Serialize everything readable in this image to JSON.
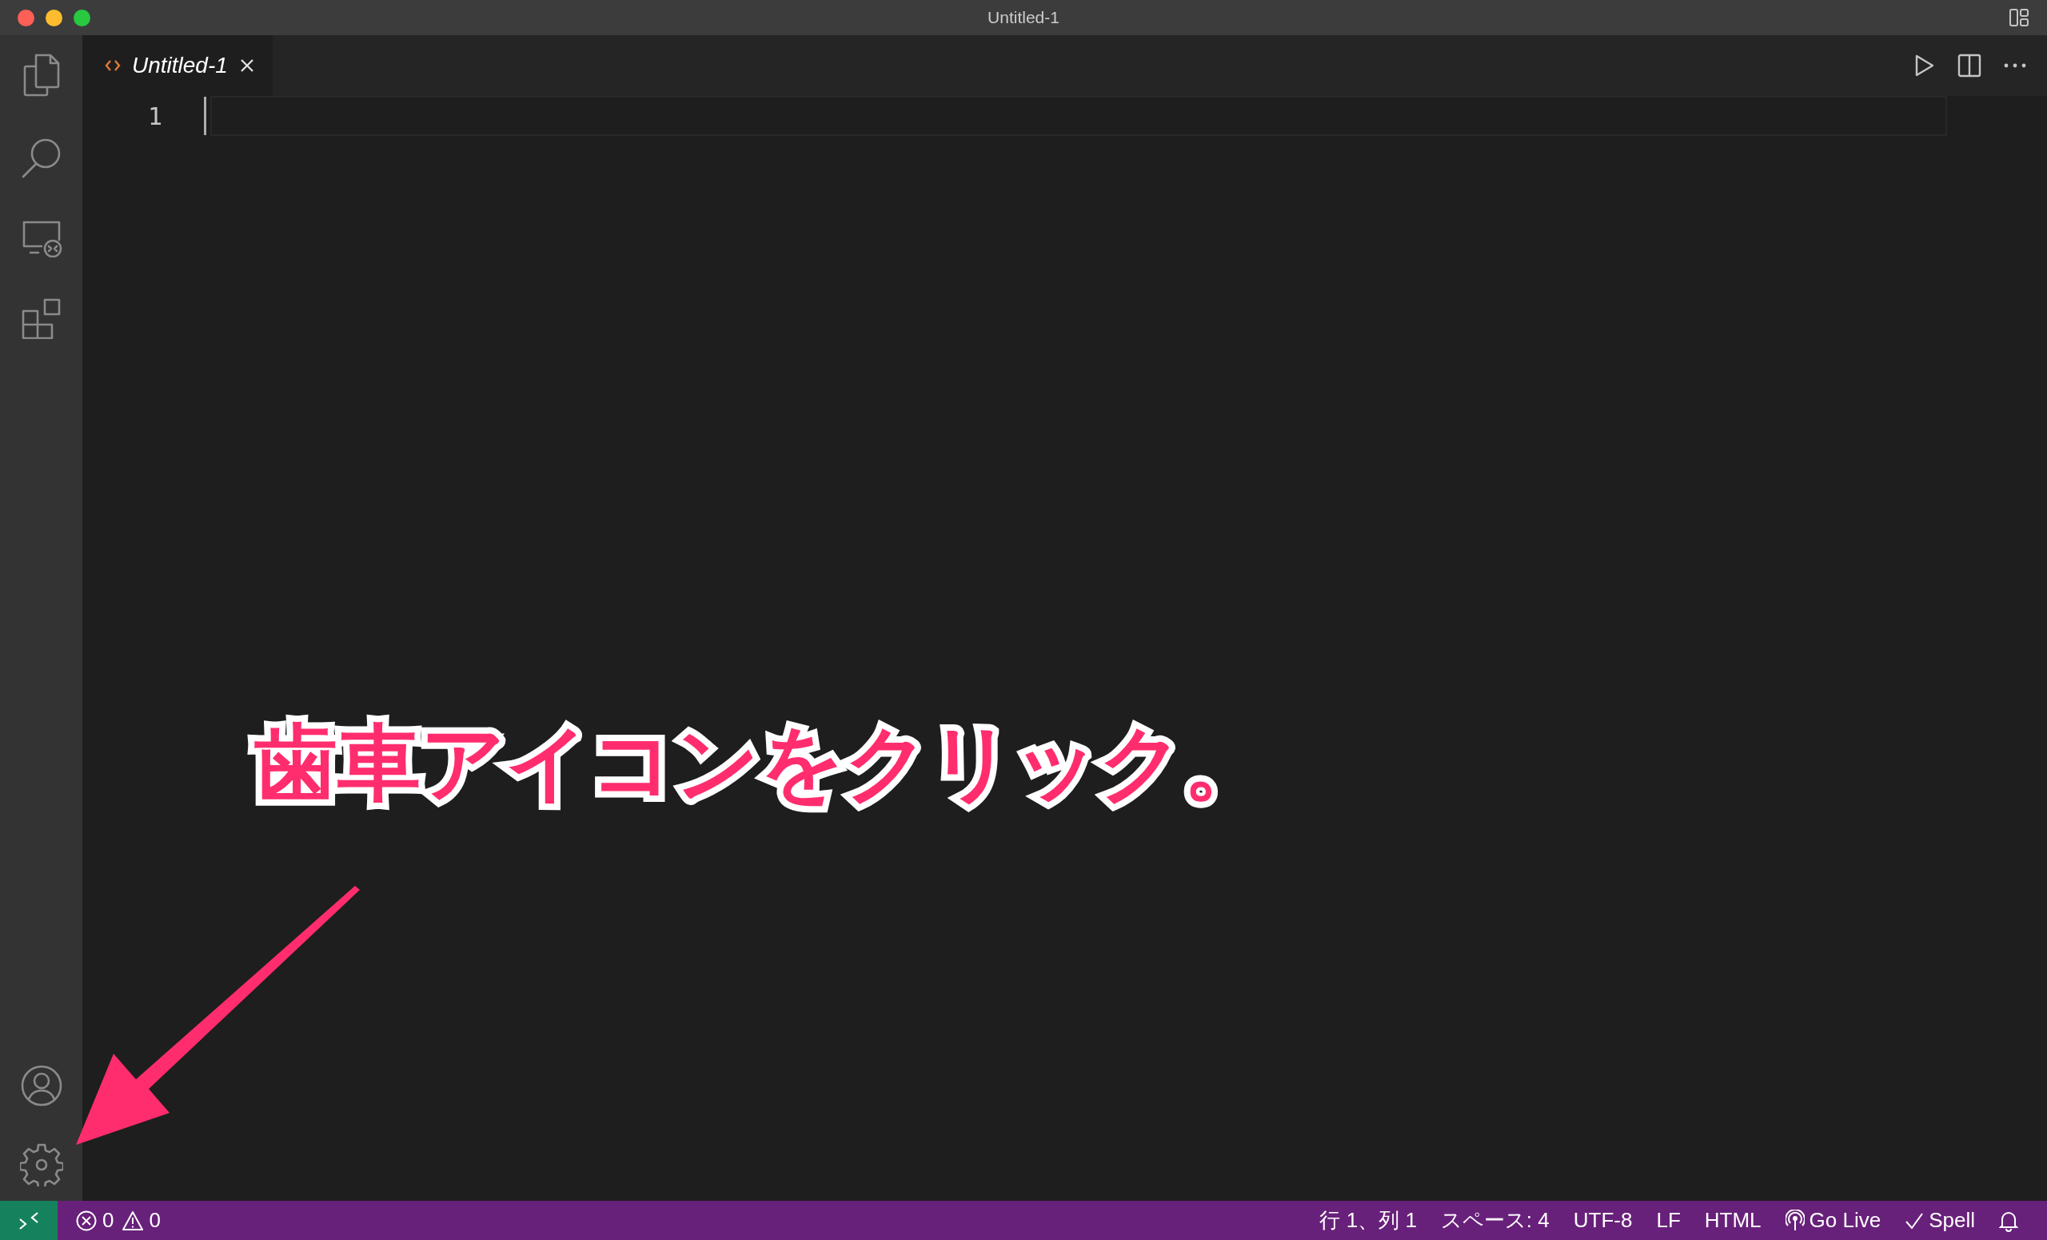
{
  "window": {
    "title": "Untitled-1"
  },
  "tabs": [
    {
      "label": "Untitled-1",
      "selected": true,
      "preview": true
    }
  ],
  "editor": {
    "line_numbers": [
      "1"
    ]
  },
  "status_bar": {
    "left": [
      {
        "kind": "errors",
        "text": "0"
      },
      {
        "kind": "warnings",
        "text": "0"
      }
    ],
    "right": [
      {
        "kind": "text",
        "text": "行 1、列 1"
      },
      {
        "kind": "text",
        "text": "スペース: 4"
      },
      {
        "kind": "text",
        "text": "UTF-8"
      },
      {
        "kind": "text",
        "text": "LF"
      },
      {
        "kind": "text",
        "text": "HTML"
      },
      {
        "kind": "go_live",
        "text": "Go Live"
      },
      {
        "kind": "spell",
        "text": "Spell"
      },
      {
        "kind": "notifications"
      }
    ]
  },
  "annotation": {
    "text": "歯車アイコンをクリック。"
  }
}
